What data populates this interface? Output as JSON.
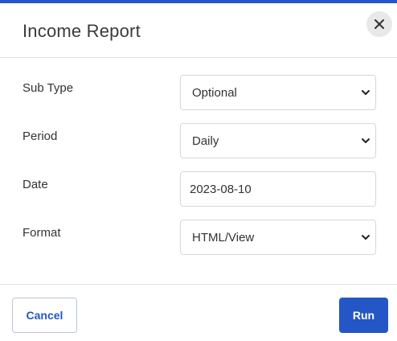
{
  "dialog": {
    "title": "Income Report",
    "close_icon": "close-icon",
    "accent_color": "#2456c5"
  },
  "form": {
    "sub_type": {
      "label": "Sub Type",
      "value": "Optional"
    },
    "period": {
      "label": "Period",
      "value": "Daily"
    },
    "date": {
      "label": "Date",
      "value": "2023-08-10"
    },
    "format": {
      "label": "Format",
      "value": "HTML/View"
    }
  },
  "footer": {
    "cancel_label": "Cancel",
    "run_label": "Run"
  }
}
